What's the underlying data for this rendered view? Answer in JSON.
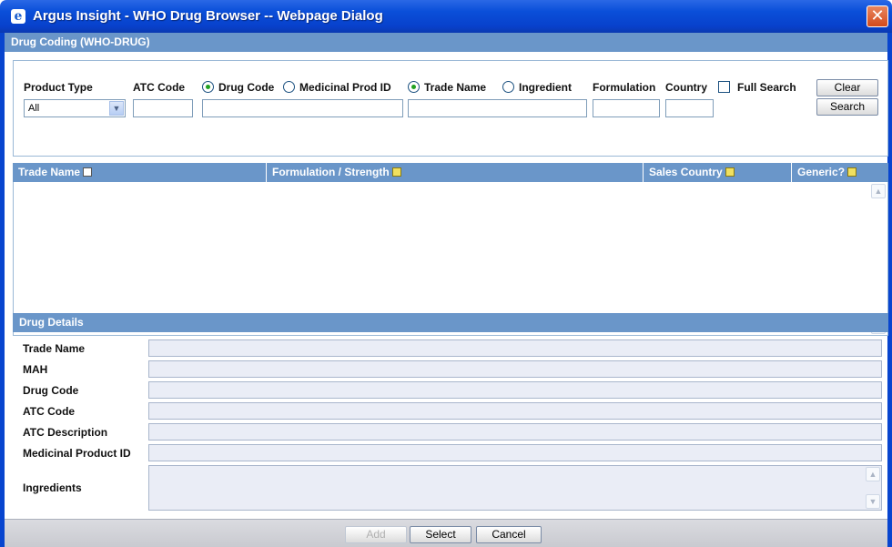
{
  "window": {
    "title": "Argus Insight - WHO Drug Browser -- Webpage Dialog",
    "close_glyph": "✕"
  },
  "header": {
    "section_title": "Drug Coding (WHO-DRUG)"
  },
  "filters": {
    "product_type_label": "Product Type",
    "product_type_value": "All",
    "atc_code_label": "ATC Code",
    "code_options": [
      {
        "label": "Drug Code",
        "selected": true
      },
      {
        "label": "Medicinal Prod ID",
        "selected": false
      }
    ],
    "name_options": [
      {
        "label": "Trade Name",
        "selected": true
      },
      {
        "label": "Ingredient",
        "selected": false
      }
    ],
    "formulation_label": "Formulation",
    "country_label": "Country",
    "full_search_label": "Full Search",
    "full_search_checked": false,
    "clear_label": "Clear",
    "search_label": "Search"
  },
  "grid": {
    "columns": [
      {
        "label": "Trade Name",
        "icon": "plus-sort-icon"
      },
      {
        "label": "Formulation / Strength",
        "icon": "sort-icon"
      },
      {
        "label": "Sales Country",
        "icon": "sort-icon"
      },
      {
        "label": "Generic?",
        "icon": "sort-icon"
      }
    ],
    "rows": []
  },
  "details": {
    "section_title": "Drug Details",
    "fields": [
      {
        "label": "Trade Name",
        "value": ""
      },
      {
        "label": "MAH",
        "value": ""
      },
      {
        "label": "Drug Code",
        "value": ""
      },
      {
        "label": "ATC Code",
        "value": ""
      },
      {
        "label": "ATC Description",
        "value": ""
      },
      {
        "label": "Medicinal Product ID",
        "value": ""
      },
      {
        "label": "Ingredients",
        "value": ""
      }
    ]
  },
  "footer": {
    "add_label": "Add",
    "select_label": "Select",
    "cancel_label": "Cancel"
  },
  "colors": {
    "titlebar": "#0a4fd9",
    "section_bar": "#6a96c9",
    "frame": "#0845cf"
  }
}
